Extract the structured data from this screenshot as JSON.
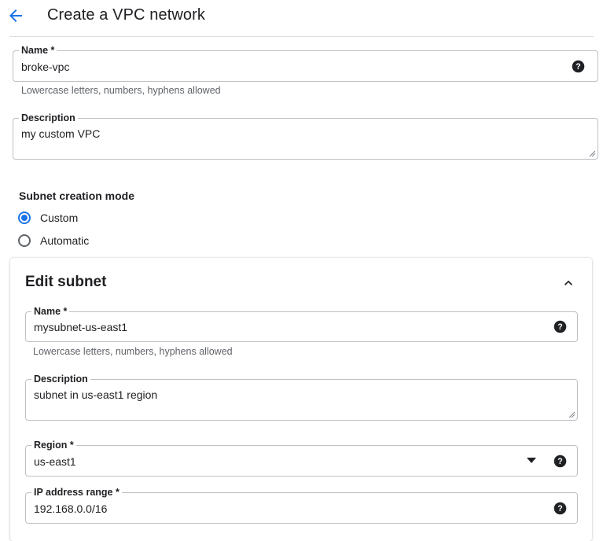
{
  "header": {
    "back_icon": "arrow-back-icon",
    "title": "Create a VPC network"
  },
  "network": {
    "name_label": "Name *",
    "name_value": "broke-vpc",
    "name_hint": "Lowercase letters, numbers, hyphens allowed",
    "description_label": "Description",
    "description_value": "my custom VPC"
  },
  "subnet_mode": {
    "label": "Subnet creation mode",
    "options": [
      {
        "label": "Custom",
        "selected": true
      },
      {
        "label": "Automatic",
        "selected": false
      }
    ]
  },
  "edit_subnet": {
    "title": "Edit subnet",
    "collapse_icon": "chevron-up-icon",
    "name_label": "Name *",
    "name_value": "mysubnet-us-east1",
    "name_hint": "Lowercase letters, numbers, hyphens allowed",
    "description_label": "Description",
    "description_value": "subnet in us-east1 region",
    "region_label": "Region *",
    "region_value": "us-east1",
    "ip_range_label": "IP address range *",
    "ip_range_value": "192.168.0.0/16"
  },
  "colors": {
    "accent": "#1a73e8",
    "text": "#202124",
    "muted": "#5f6368",
    "border": "#bdc1c6"
  }
}
